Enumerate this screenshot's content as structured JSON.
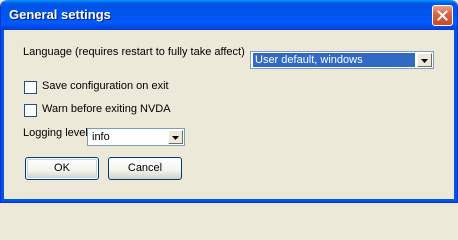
{
  "window": {
    "title": "General settings"
  },
  "language": {
    "label": "Language (requires restart to fully take affect)",
    "value": "User default, windows"
  },
  "save_config": {
    "label": "Save configuration on exit",
    "checked": false
  },
  "warn_exit": {
    "label": "Warn before exiting NVDA",
    "checked": false
  },
  "logging": {
    "label": "Logging level",
    "value": "info"
  },
  "buttons": {
    "ok": "OK",
    "cancel": "Cancel"
  },
  "icons": {
    "close": "close-icon",
    "dropdown": "chevron-down-icon"
  },
  "colors": {
    "titlebar": "#0054e3",
    "selection": "#316ac5",
    "close": "#d86547"
  }
}
